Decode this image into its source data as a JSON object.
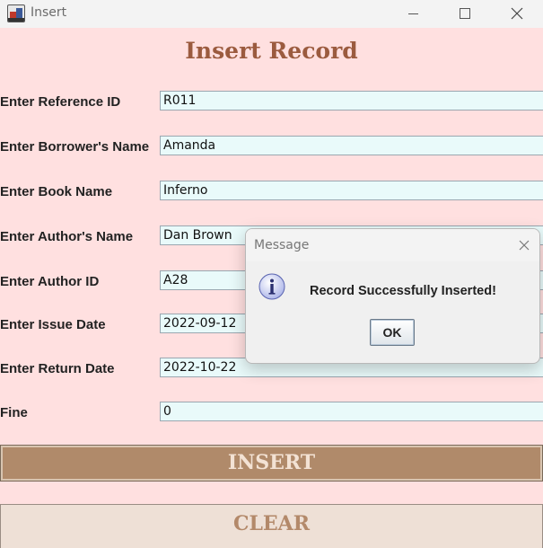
{
  "window": {
    "title": "Insert"
  },
  "form": {
    "title": "Insert Record",
    "fields": [
      {
        "label": "Enter Reference ID",
        "value": "R011"
      },
      {
        "label": "Enter Borrower's Name",
        "value": "Amanda"
      },
      {
        "label": "Enter Book Name",
        "value": "Inferno"
      },
      {
        "label": "Enter Author's Name",
        "value": "Dan Brown"
      },
      {
        "label": "Enter Author ID",
        "value": "A28"
      },
      {
        "label": "Enter Issue Date",
        "value": "2022-09-12"
      },
      {
        "label": "Enter Return Date",
        "value": "2022-10-22"
      },
      {
        "label": "Fine",
        "value": "0"
      }
    ],
    "insert_label": "INSERT",
    "clear_label": "CLEAR"
  },
  "dialog": {
    "title": "Message",
    "message": "Record Successfully Inserted!",
    "ok_label": "OK",
    "icon": "info-icon"
  },
  "colors": {
    "background": "#ffe0e0",
    "title": "#9b5b3f",
    "insert_button": "#b08a6a",
    "clear_button": "#eee0d6",
    "field_bg": "#e9fafa"
  }
}
